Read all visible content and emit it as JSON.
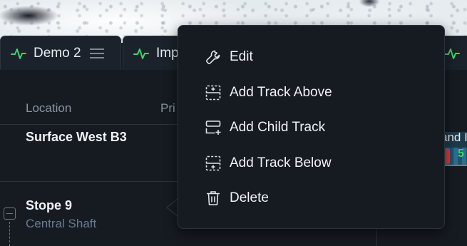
{
  "tabs": [
    {
      "label": "Demo 2",
      "icon": "pulse-icon",
      "has_menu": true
    },
    {
      "label": "Imp",
      "icon": "pulse-icon"
    },
    {
      "label": "",
      "icon": "pulse-icon"
    }
  ],
  "table": {
    "headers": {
      "location": "Location",
      "priority": "Pri"
    },
    "rows": [
      {
        "title": "Surface West B3",
        "subtitle": ""
      },
      {
        "title": "Stope 9",
        "subtitle": "Central Shaft"
      }
    ]
  },
  "track_preview": {
    "text": "and I",
    "value": "5"
  },
  "context_menu": {
    "items": [
      {
        "label": "Edit",
        "icon": "wrench-icon"
      },
      {
        "label": "Add Track Above",
        "icon": "add-track-above-icon"
      },
      {
        "label": "Add Child Track",
        "icon": "add-child-track-icon"
      },
      {
        "label": "Add Track Below",
        "icon": "add-track-below-icon"
      },
      {
        "label": "Delete",
        "icon": "trash-icon"
      }
    ]
  },
  "colors": {
    "accent_green": "#3fd46a",
    "background": "#161b22",
    "menu_border": "#2b333d"
  }
}
